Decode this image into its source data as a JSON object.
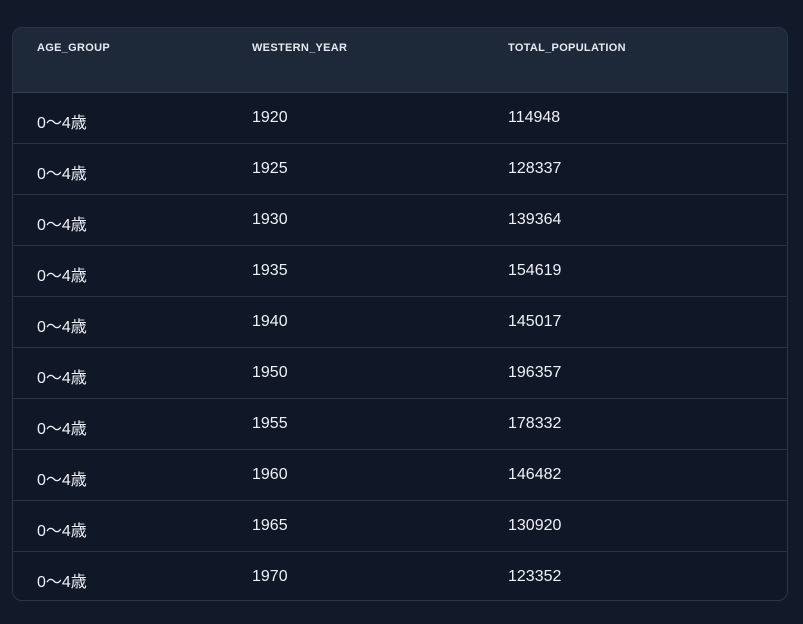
{
  "table": {
    "columns": [
      "AGE_GROUP",
      "WESTERN_YEAR",
      "TOTAL_POPULATION"
    ],
    "rows": [
      [
        "0〜4歳",
        "1920",
        "114948"
      ],
      [
        "0〜4歳",
        "1925",
        "128337"
      ],
      [
        "0〜4歳",
        "1930",
        "139364"
      ],
      [
        "0〜4歳",
        "1935",
        "154619"
      ],
      [
        "0〜4歳",
        "1940",
        "145017"
      ],
      [
        "0〜4歳",
        "1950",
        "196357"
      ],
      [
        "0〜4歳",
        "1955",
        "178332"
      ],
      [
        "0〜4歳",
        "1960",
        "146482"
      ],
      [
        "0〜4歳",
        "1965",
        "130920"
      ],
      [
        "0〜4歳",
        "1970",
        "123352"
      ]
    ]
  },
  "colors": {
    "page_background": "#121929",
    "table_body": "#101828",
    "header_background": "#1d2939",
    "row_border": "#2b3443",
    "text": "#eef1f5"
  }
}
